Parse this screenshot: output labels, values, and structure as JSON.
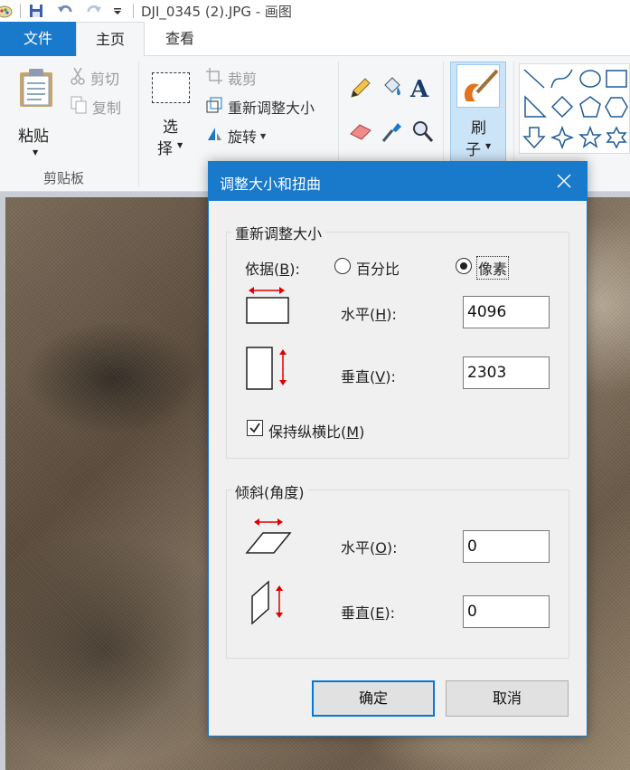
{
  "window": {
    "title": "DJI_0345 (2).JPG - 画图"
  },
  "tabs": {
    "file": "文件",
    "home": "主页",
    "view": "查看"
  },
  "clipboard": {
    "paste": "粘贴",
    "cut": "剪切",
    "copy": "复制",
    "group": "剪贴板"
  },
  "image": {
    "select_1": "选",
    "select_2": "择",
    "crop": "裁剪",
    "resize": "重新调整大小",
    "rotate": "旋转"
  },
  "brush": {
    "label_1": "刷",
    "label_2": "子"
  },
  "colors": {
    "accent": "#1979ca",
    "ribbon_bg": "#f5f6f7",
    "dialog_bg": "#f0f0f0"
  },
  "dialog": {
    "title": "调整大小和扭曲",
    "resize_group": "重新调整大小",
    "by_label": "依据(",
    "by_key": "B",
    "by_end": "):",
    "percent": "百分比",
    "pixels": "像素",
    "horizontal_label": "水平(",
    "horizontal_key": "H",
    "horizontal_end": "):",
    "horizontal_value": "4096",
    "vertical_label": "垂直(",
    "vertical_key": "V",
    "vertical_end": "):",
    "vertical_value": "2303",
    "keep_ratio": "保持纵横比(",
    "keep_ratio_key": "M",
    "keep_ratio_end": ")",
    "skew_group": "倾斜(角度)",
    "skew_h_label": "水平(",
    "skew_h_key": "O",
    "skew_h_end": "):",
    "skew_h_value": "0",
    "skew_v_label": "垂直(",
    "skew_v_key": "E",
    "skew_v_end": "):",
    "skew_v_value": "0",
    "ok": "确定",
    "cancel": "取消"
  }
}
